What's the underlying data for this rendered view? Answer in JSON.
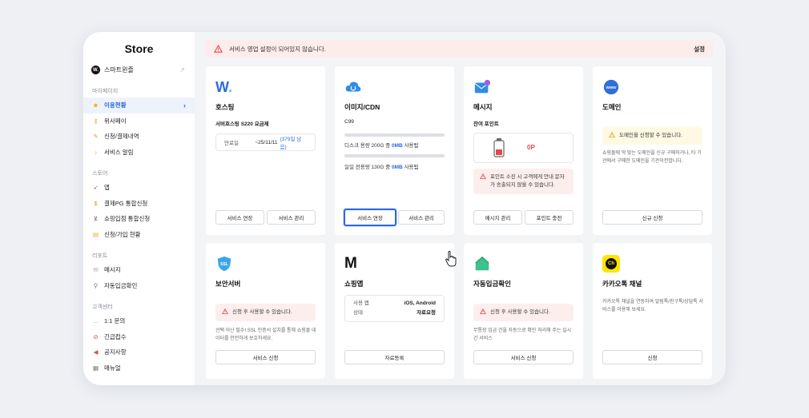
{
  "sidebar": {
    "logo": "Store",
    "store_name": "스마트윈즐",
    "sections": [
      {
        "title": "마이페이지",
        "items": [
          {
            "label": "이용현황",
            "icon": "smile-icon",
            "active": true
          },
          {
            "label": "위사페이",
            "icon": "key-icon"
          },
          {
            "label": "신청/결제내역",
            "icon": "note-icon"
          },
          {
            "label": "서비스 알림",
            "icon": "bell-icon"
          }
        ]
      },
      {
        "title": "스토어",
        "items": [
          {
            "label": "앱",
            "icon": "rocket-icon"
          },
          {
            "label": "결제PG 통합신청",
            "icon": "moneybag-icon"
          },
          {
            "label": "쇼핑입점 통합신청",
            "icon": "cart-icon"
          },
          {
            "label": "신청/가입 현황",
            "icon": "list-icon"
          }
        ]
      },
      {
        "title": "리포트",
        "items": [
          {
            "label": "메시지",
            "icon": "envelope-icon"
          },
          {
            "label": "자동입금확인",
            "icon": "magnifier-icon"
          }
        ]
      },
      {
        "title": "고객센터",
        "items": [
          {
            "label": "1:1 문의",
            "icon": "chat-icon"
          },
          {
            "label": "긴급접수",
            "icon": "prohibited-icon"
          },
          {
            "label": "공지사항",
            "icon": "megaphone-icon"
          },
          {
            "label": "매뉴얼",
            "icon": "book-icon"
          }
        ]
      }
    ]
  },
  "alert": {
    "text": "서비스 영업 설정이 되어있지 않습니다.",
    "action": "설정"
  },
  "cards": {
    "hosting": {
      "title": "호스팅",
      "plan": "서버호스팅 S220 요금제",
      "expiry_label": "만료일",
      "expiry_date": "~25/11/11",
      "remaining": "(379일 남음)",
      "btn1": "서비스 연장",
      "btn2": "서비스 관리"
    },
    "cdn": {
      "title": "이미지/CDN",
      "plan": "C99",
      "disk_prefix": "디스크 용량 200G 중",
      "disk_used": "0MB",
      "disk_suffix": "사용됨",
      "traffic_prefix": "일일 전용량 130G 중",
      "traffic_used": "0MB",
      "traffic_suffix": "사용됨",
      "btn1": "서비스 연장",
      "btn2": "서비스 관리"
    },
    "message": {
      "title": "메시지",
      "sub": "잔여 포인트",
      "points": "0P",
      "warning": "포인트 소진 시 고객에게 안내 문자가 송출되지 않을 수 있습니다.",
      "btn1": "메시지 관리",
      "btn2": "포인트 충전"
    },
    "domain": {
      "title": "도메인",
      "warning": "도메인을 신청할 수 있습니다.",
      "desc": "쇼핑몰에 딱 맞는 도메인을 신규 구매하거나, 타 기관에서 구매한 도메인을 기관이전합니다.",
      "btn": "신규 신청"
    },
    "ssl": {
      "title": "보안서버",
      "icon_text": "SSL",
      "warning": "신청 후 사용할 수 있습니다.",
      "desc": "선택 아닌 필수! SSL 인증서 설치를 통해 쇼핑몰 데이터를 안전하게 보호하세요.",
      "btn": "서비스 신청"
    },
    "app": {
      "title": "쇼핑앱",
      "row1_label": "사용 앱",
      "row1_value": "iOS, Android",
      "row2_label": "상태",
      "row2_value": "자료요청",
      "btn": "자료등록"
    },
    "deposit": {
      "title": "자동입금확인",
      "warning": "신청 후 사용할 수 있습니다.",
      "desc": "무통장 입금 건을 자동으로 확인 처리해 주는 실시간 서비스",
      "btn": "서비스 신청"
    },
    "kakao": {
      "title": "카카오톡 채널",
      "icon_text": "Ch",
      "desc": "카카오톡 채널을 연동하여 알림톡/친구톡/상담톡 서비스를 이용해 보세요.",
      "btn": "신청"
    }
  },
  "colors": {
    "accent": "#2b6ae0",
    "warning_bg": "#fdeeee",
    "warn_red": "#e5474b",
    "notice_bg": "#fff8e3"
  }
}
